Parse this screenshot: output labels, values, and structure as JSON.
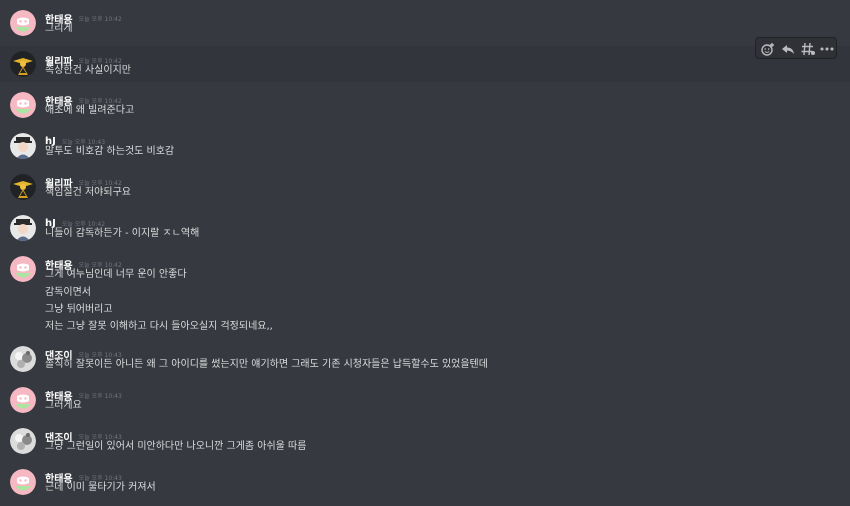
{
  "timestamp": "오늘 오후 10:42",
  "timestamp2": "오늘 오후 10:43",
  "users": {
    "taeyong": "한태용",
    "willipa": "윌리파",
    "hj": "hJ",
    "danjoi": "댄조이"
  },
  "messages": {
    "m1": {
      "lines": [
        "그리게"
      ]
    },
    "m2": {
      "lines": [
        "속상한건 사실이지만"
      ]
    },
    "m3": {
      "lines": [
        "애초에 왜 빌려준다고"
      ]
    },
    "m4": {
      "lines": [
        "말투도 비호감 하는것도 비호감"
      ]
    },
    "m5": {
      "lines": [
        "책임질건 저야되구요"
      ]
    },
    "m6": {
      "lines": [
        "니들이 감독하든가 - 이지랄 ㅈㄴ역해"
      ]
    },
    "m7": {
      "lines": [
        "그게 여누님인데 너무 운이 안좋다",
        "감독이면서",
        "그냥 뒤어버리고",
        "저는 그냥 잘못 이해하고 다시 들아오실지 걱정되네요,,"
      ]
    },
    "m8": {
      "lines": [
        "솔직히 잘못이든 아니든 왜 그 아이디를 썼는지만 얘기하면 그래도 기존 시청자들은 납득할수도 있었을텐데"
      ]
    },
    "m9": {
      "lines": [
        "그러게요"
      ]
    },
    "m10": {
      "lines": [
        "그냥 그런일이 있어서 미안하다만 나오니깐 그게좀 아쉬울 따름"
      ]
    },
    "m11": {
      "lines": [
        "근데 이미 물타기가 커져서"
      ]
    }
  },
  "toolbar": {
    "icons": [
      "add-reaction-icon",
      "reply-icon",
      "create-thread-icon",
      "more-icon"
    ]
  },
  "colors": {
    "background": "#36393f",
    "hover": "#32353b",
    "username": "#ffffff",
    "text": "#dcddde",
    "timestamp": "#72767d",
    "avatar_default": "#f6b8c2"
  }
}
